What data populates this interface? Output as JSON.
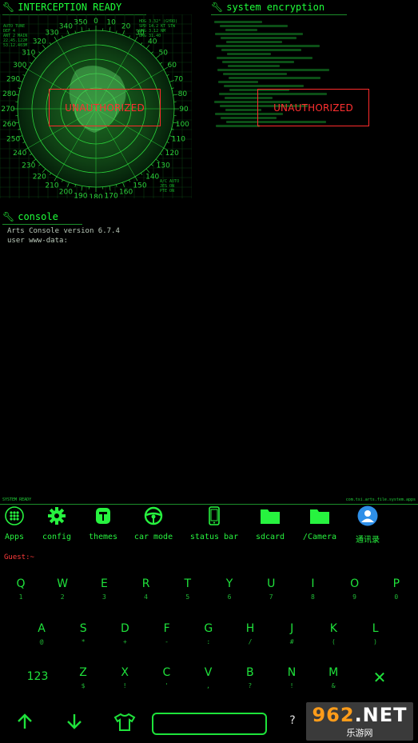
{
  "radar_panel": {
    "title": "INTERCEPTION READY",
    "overlay": "UNAUTHORIZED",
    "bearings": [
      "350",
      "0",
      "10",
      "20",
      "30",
      "40",
      "50",
      "60",
      "70",
      "80",
      "90",
      "100",
      "110",
      "120",
      "130",
      "140",
      "150",
      "160",
      "170",
      "180",
      "190",
      "200",
      "210",
      "220",
      "230",
      "240",
      "250",
      "260",
      "270",
      "280",
      "290",
      "300",
      "310",
      "320",
      "330",
      "340"
    ],
    "readout_left": "AUTO TUNE\nDEF 4\nANT 2 MAIN\n22.45.122M\n53.12.403M",
    "readout_right": "HDG 3.32° (GYRO)\nSPD 14.2 KT STW\nRNG 3.12 NM\nBRG 31.40",
    "readout_bottom": "A/C AUTO\nJES ON\nPTE ON"
  },
  "encryption_panel": {
    "title": "system encryption",
    "overlay": "UNAUTHORIZED"
  },
  "console_panel": {
    "title": "console",
    "line1": "Arts Console version 6.7.4",
    "line2": "user www-data:"
  },
  "status_bar": {
    "left": "SYSTEM READY",
    "right": "com.tsi.arts.file.system.apps"
  },
  "dock": [
    {
      "label": "Apps",
      "icon": "apps-grid-icon"
    },
    {
      "label": "config",
      "icon": "gear-icon"
    },
    {
      "label": "themes",
      "icon": "paint-roller-icon"
    },
    {
      "label": "car mode",
      "icon": "steering-wheel-icon"
    },
    {
      "label": "status bar",
      "icon": "phone-icon"
    },
    {
      "label": "sdcard",
      "icon": "folder-icon"
    },
    {
      "label": "/Camera",
      "icon": "folder-icon"
    },
    {
      "label": "通讯录",
      "icon": "contacts-icon"
    }
  ],
  "prompt": "Guest:~",
  "keyboard": {
    "row1": [
      [
        "Q",
        "1"
      ],
      [
        "W",
        "2"
      ],
      [
        "E",
        "3"
      ],
      [
        "R",
        "4"
      ],
      [
        "T",
        "5"
      ],
      [
        "Y",
        "6"
      ],
      [
        "U",
        "7"
      ],
      [
        "I",
        "8"
      ],
      [
        "O",
        "9"
      ],
      [
        "P",
        "0"
      ]
    ],
    "row2": [
      [
        "A",
        "@"
      ],
      [
        "S",
        "*"
      ],
      [
        "D",
        "+"
      ],
      [
        "F",
        "-"
      ],
      [
        "G",
        ":"
      ],
      [
        "H",
        "/"
      ],
      [
        "J",
        "#"
      ],
      [
        "K",
        "("
      ],
      [
        "L",
        ")"
      ]
    ],
    "row3": [
      [
        "Z",
        "$"
      ],
      [
        "X",
        "!"
      ],
      [
        "C",
        "'"
      ],
      [
        "V",
        ","
      ],
      [
        "B",
        "?"
      ],
      [
        "N",
        "!"
      ],
      [
        "M",
        "&"
      ]
    ],
    "numbers_key": "123",
    "question_key": "?"
  },
  "watermark": {
    "big_prefix": "962",
    "big_suffix": ".NET",
    "small": "乐游网"
  },
  "colors": {
    "accent": "#19e619",
    "alert": "#ff3030",
    "background": "#000000"
  }
}
